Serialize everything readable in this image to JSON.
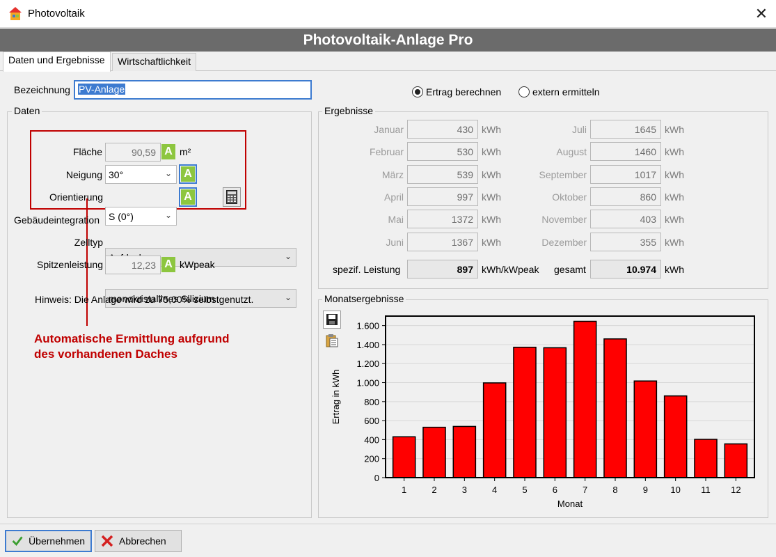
{
  "window": {
    "title": "Photovoltaik",
    "close": "✕"
  },
  "header": {
    "title": "Photovoltaik-Anlage Pro"
  },
  "tabs": [
    {
      "label": "Daten und Ergebnisse"
    },
    {
      "label": "Wirtschaftlichkeit"
    }
  ],
  "bezeichnung": {
    "label": "Bezeichnung",
    "value": "PV-Anlage"
  },
  "radio": {
    "option1": "Ertrag berechnen",
    "option2": "extern ermitteln",
    "selected": "Ertrag berechnen"
  },
  "daten": {
    "group_label": "Daten",
    "flaeche": {
      "label": "Fläche",
      "value": "90,59",
      "unit": "m²"
    },
    "neigung": {
      "label": "Neigung",
      "value": "30°"
    },
    "orientierung": {
      "label": "Orientierung",
      "value": "S (0°)"
    },
    "gebaeude": {
      "label": "Gebäudeintegration",
      "value": "Aufdach"
    },
    "zelltyp": {
      "label": "Zelltyp",
      "value": "monokristallines Silizium"
    },
    "spitzen": {
      "label": "Spitzenleistung",
      "value": "12,23",
      "unit": "kWpeak"
    },
    "hinweis": "Hinweis: Die Anlage wird zu 75,00% selbstgenutzt.",
    "badge_letter": "A",
    "annotation_line1": "Automatische Ermittlung aufgrund",
    "annotation_line2": "des vorhandenen Daches"
  },
  "ergebnisse": {
    "group_label": "Ergebnisse",
    "months_left": [
      {
        "label": "Januar",
        "value": "430",
        "unit": "kWh"
      },
      {
        "label": "Februar",
        "value": "530",
        "unit": "kWh"
      },
      {
        "label": "März",
        "value": "539",
        "unit": "kWh"
      },
      {
        "label": "April",
        "value": "997",
        "unit": "kWh"
      },
      {
        "label": "Mai",
        "value": "1372",
        "unit": "kWh"
      },
      {
        "label": "Juni",
        "value": "1367",
        "unit": "kWh"
      }
    ],
    "months_right": [
      {
        "label": "Juli",
        "value": "1645",
        "unit": "kWh"
      },
      {
        "label": "August",
        "value": "1460",
        "unit": "kWh"
      },
      {
        "label": "September",
        "value": "1017",
        "unit": "kWh"
      },
      {
        "label": "Oktober",
        "value": "860",
        "unit": "kWh"
      },
      {
        "label": "November",
        "value": "403",
        "unit": "kWh"
      },
      {
        "label": "Dezember",
        "value": "355",
        "unit": "kWh"
      }
    ],
    "spezif": {
      "label": "spezif. Leistung",
      "value": "897",
      "unit": "kWh/kWpeak"
    },
    "gesamt": {
      "label": "gesamt",
      "value": "10.974",
      "unit": "kWh"
    }
  },
  "monats": {
    "group_label": "Monatsergebnisse"
  },
  "chart_data": {
    "type": "bar",
    "categories": [
      "1",
      "2",
      "3",
      "4",
      "5",
      "6",
      "7",
      "8",
      "9",
      "10",
      "11",
      "12"
    ],
    "values": [
      430,
      530,
      539,
      997,
      1372,
      1367,
      1645,
      1460,
      1017,
      860,
      403,
      355
    ],
    "xlabel": "Monat",
    "ylabel": "Ertrag in kWh",
    "ylim": [
      0,
      1700
    ],
    "yticks": [
      "0",
      "200",
      "400",
      "600",
      "800",
      "1.000",
      "1.200",
      "1.400",
      "1.600"
    ],
    "bar_color": "#ff0000"
  },
  "buttons": {
    "ok": "Übernehmen",
    "cancel": "Abbrechen"
  },
  "colors": {
    "header": "#6b6b6b",
    "accent": "#3d7bd0",
    "badge": "#8dc63f",
    "annotation": "#c00000"
  }
}
